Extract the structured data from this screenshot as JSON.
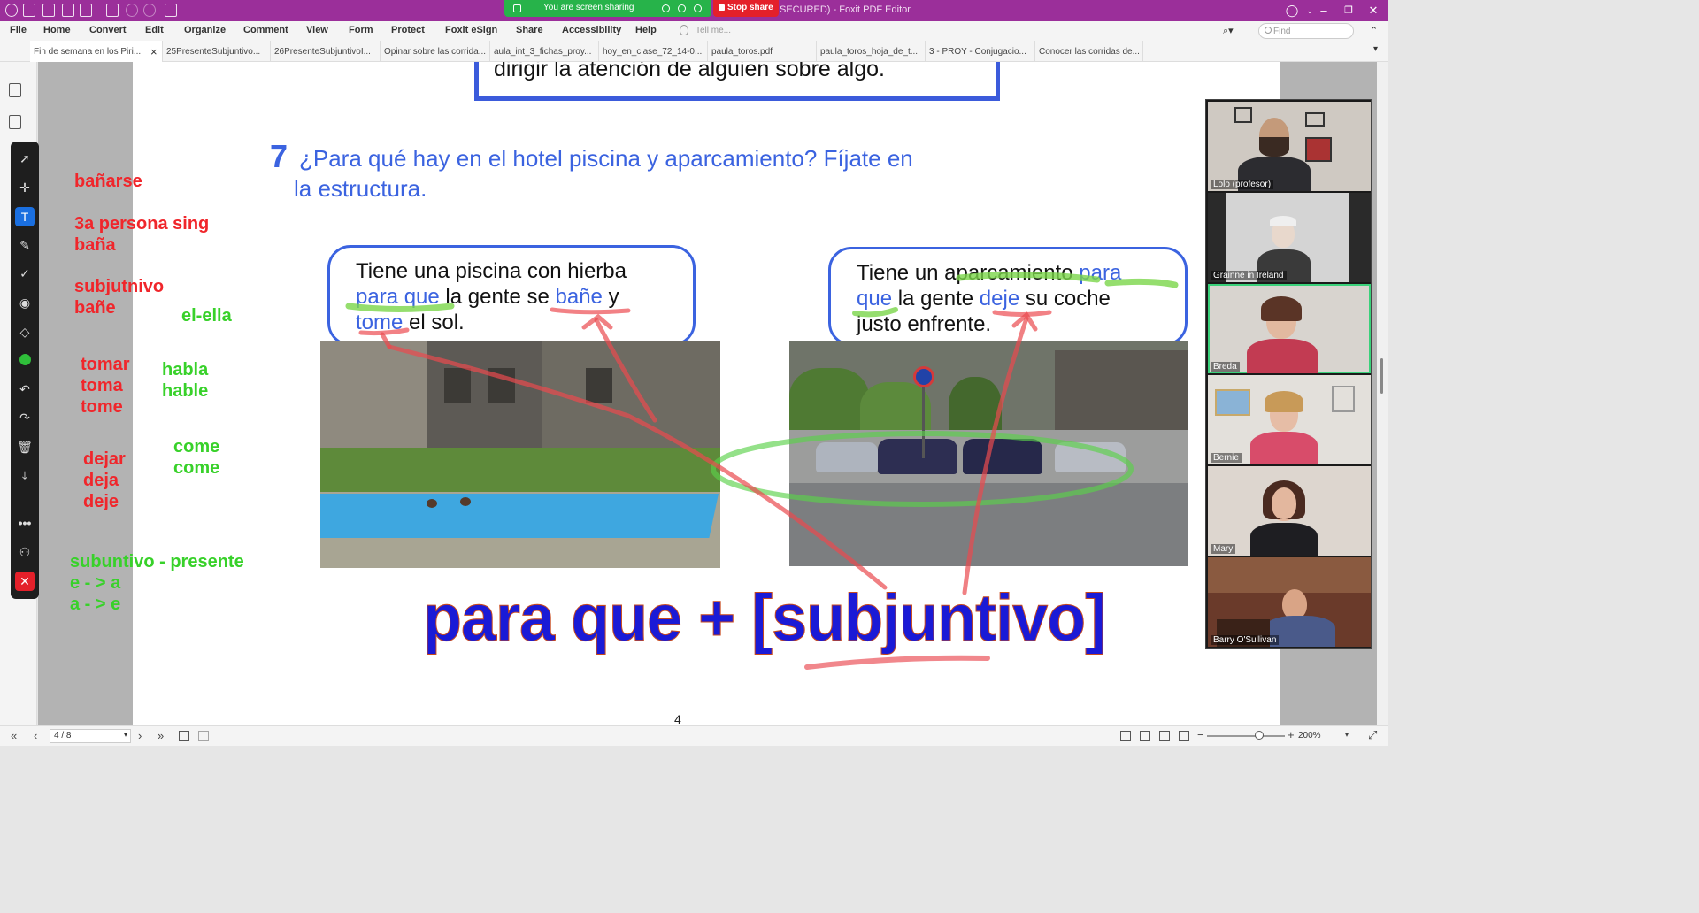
{
  "window": {
    "title": "SECURED) - Foxit PDF Editor",
    "share_banner": "You are screen sharing",
    "stop_share": "Stop share"
  },
  "menu": [
    "File",
    "Home",
    "Convert",
    "Edit",
    "Organize",
    "Comment",
    "View",
    "Form",
    "Protect",
    "Foxit eSign",
    "Share",
    "Accessibility",
    "Help"
  ],
  "tell_me_placeholder": "Tell me...",
  "find_placeholder": "Find",
  "tabs": [
    "Fin de semana en los Piri...",
    "25PresenteSubjuntivo...",
    "26PresenteSubjuntivoI...",
    "Opinar sobre las corrida...",
    "aula_int_3_fichas_proy...",
    "hoy_en_clase_72_14-0...",
    "paula_toros.pdf",
    "paula_toros_hoja_de_t...",
    "3 - PROY - Conjugacio...",
    "Conocer las corridas de..."
  ],
  "page": {
    "prev_box_text": "dirigir la atención de alguien sobre algo.",
    "question_number": "7",
    "question_line1": "¿Para qué hay en el hotel piscina y aparcamiento? Fíjate en",
    "question_line2": "la estructura.",
    "bubble_left": {
      "l1": "Tiene una piscina con hierba",
      "l2a": "para que",
      "l2b": " la gente se ",
      "l2c": "bañe",
      "l2d": " y",
      "l3a": "tome",
      "l3b": " el sol."
    },
    "bubble_right": {
      "l1a": "Tiene un aparcamiento ",
      "l1b": "para",
      "l2a": "que",
      "l2b": " la gente ",
      "l2c": "deje",
      "l2d": " su coche",
      "l3": "justo enfrente."
    },
    "formula": "para que + [subjuntivo]",
    "page_mark": "4"
  },
  "notes": {
    "red": [
      "bañarse",
      "3a persona sing",
      "baña",
      "subjutnivo",
      "bañe",
      "tomar",
      "toma",
      "tome",
      "dejar",
      "deja",
      "deje"
    ],
    "green": [
      "el-ella",
      "habla",
      "hable",
      "come",
      "come",
      "subuntivo - presente",
      "e - > a",
      "a - > e"
    ]
  },
  "participants": [
    "Lolo (profesor)",
    "Grainne in Ireland",
    "Breda",
    "Bernie",
    "Mary",
    "Barry O'Sullivan"
  ],
  "status": {
    "page_display": "4 / 8",
    "zoom": "200%"
  },
  "colors": {
    "titlebar": "#9b2f9a",
    "share_green": "#27b34a",
    "stop_red": "#e4202a",
    "ink_red": "#f0262b",
    "ink_green": "#38d12a",
    "text_blue": "#3b63e0",
    "formula_blue": "#1a1ad6"
  }
}
